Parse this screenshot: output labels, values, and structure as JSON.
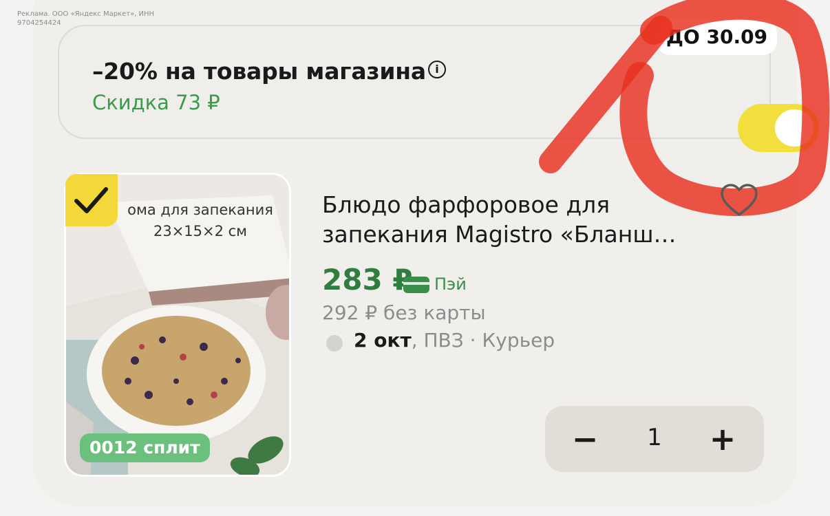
{
  "ad_note": "Реклама. ООО «Яндекс Маркет», ИНН 9704254424",
  "promo": {
    "title": "–20% на товары магазина",
    "info_icon": "info-icon",
    "discount": "Скидка 73 ₽",
    "until": "ДО 30.09",
    "toggle_on": true,
    "toggle_color": "#f2df3e"
  },
  "product": {
    "image_caption": "ома для запекания 23×15×2 см",
    "checked": true,
    "split_badge": "0012 сплит",
    "title": "Блюдо фарфоровое для запекания Magistro «Бланш…",
    "favorite_icon": "heart-icon",
    "price": "283 ₽",
    "pay_label": "Пэй",
    "old_price": "292 ₽ без карты",
    "delivery_date": "2 окт",
    "delivery_rest": ", ПВЗ · Курьер",
    "quantity": "1",
    "minus_label": "−",
    "plus_label": "+"
  },
  "colors": {
    "price_green": "#2f7d3f",
    "discount_green": "#3b9a4c",
    "accent_yellow": "#f4d83a",
    "annotation_red": "#e8301e"
  }
}
